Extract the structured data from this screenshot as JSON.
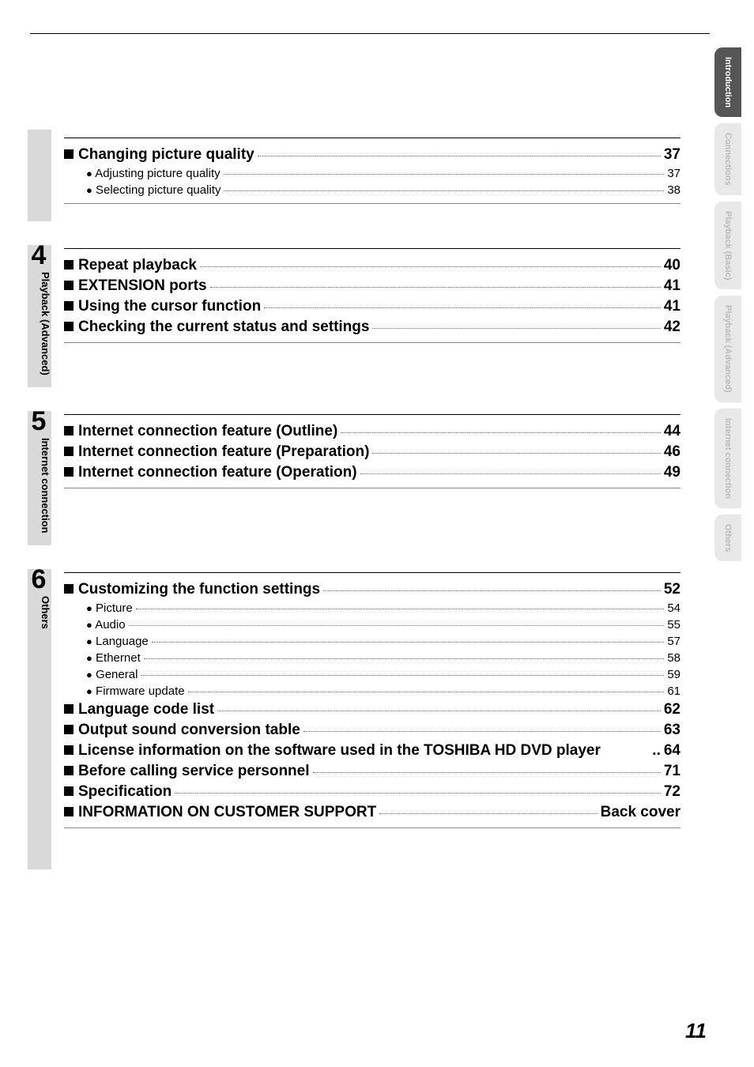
{
  "page_number": "11",
  "side_tabs": [
    {
      "label": "Introduction",
      "active": true
    },
    {
      "label": "Connections",
      "active": false
    },
    {
      "label": "Playback\n(Basic)",
      "active": false
    },
    {
      "label": "Playback\n(Advanced)",
      "active": false
    },
    {
      "label": "Internet\nconnection",
      "active": false
    },
    {
      "label": "Others",
      "active": false
    }
  ],
  "sections": [
    {
      "number": "",
      "label": "",
      "rows": [
        {
          "type": "h",
          "title": "Changing picture quality",
          "page": "37"
        },
        {
          "type": "s",
          "title": "Adjusting picture quality",
          "page": "37"
        },
        {
          "type": "s",
          "title": "Selecting picture quality",
          "page": "38"
        }
      ]
    },
    {
      "number": "4",
      "label": "Playback (Advanced)",
      "rows": [
        {
          "type": "h",
          "title": "Repeat playback",
          "page": "40"
        },
        {
          "type": "h",
          "title": "EXTENSION ports",
          "page": "41"
        },
        {
          "type": "h",
          "title": "Using the cursor function",
          "page": "41"
        },
        {
          "type": "h",
          "title": "Checking the current status and settings",
          "page": "42"
        }
      ]
    },
    {
      "number": "5",
      "label": "Internet connection",
      "rows": [
        {
          "type": "h",
          "title": "Internet connection feature (Outline)",
          "page": "44"
        },
        {
          "type": "h",
          "title": "Internet connection feature (Preparation)",
          "page": "46"
        },
        {
          "type": "h",
          "title": "Internet connection feature (Operation)",
          "page": "49"
        }
      ]
    },
    {
      "number": "6",
      "label": "Others",
      "rows": [
        {
          "type": "h",
          "title": "Customizing the function settings",
          "page": "52"
        },
        {
          "type": "s",
          "title": "Picture",
          "page": "54"
        },
        {
          "type": "s",
          "title": "Audio",
          "page": "55"
        },
        {
          "type": "s",
          "title": "Language",
          "page": "57"
        },
        {
          "type": "s",
          "title": "Ethernet",
          "page": "58"
        },
        {
          "type": "s",
          "title": "General",
          "page": "59"
        },
        {
          "type": "s",
          "title": "Firmware update",
          "page": "61"
        },
        {
          "type": "h",
          "title": "Language code list",
          "page": "62"
        },
        {
          "type": "h",
          "title": "Output sound conversion table",
          "page": "63"
        },
        {
          "type": "h",
          "title": "License information on the software used in the TOSHIBA HD DVD player",
          "page": "64",
          "noleader": true
        },
        {
          "type": "h",
          "title": "Before calling service personnel",
          "page": "71"
        },
        {
          "type": "h",
          "title": "Specification",
          "page": "72"
        },
        {
          "type": "h",
          "title": "INFORMATION ON CUSTOMER SUPPORT",
          "page": "Back cover"
        }
      ]
    }
  ]
}
